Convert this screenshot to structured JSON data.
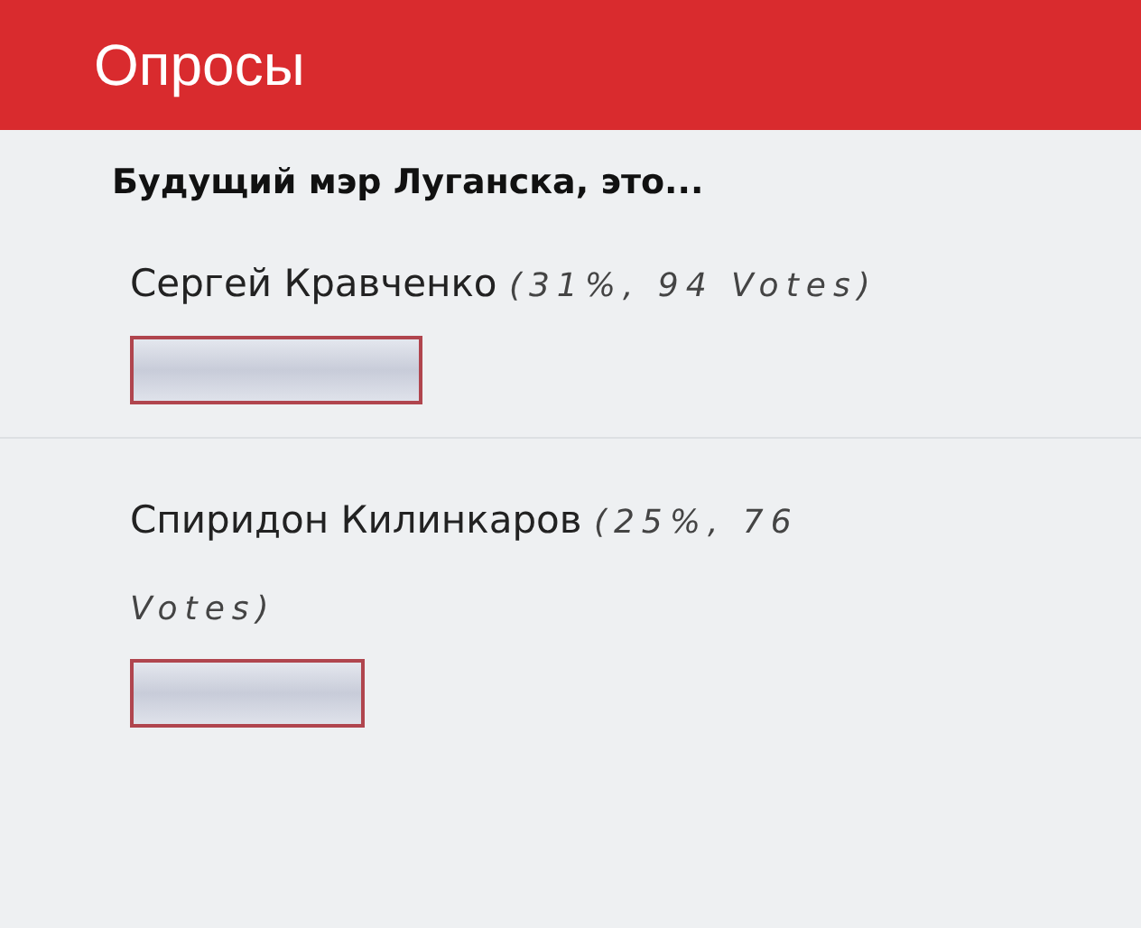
{
  "header": {
    "title": "Опросы"
  },
  "poll": {
    "question": "Будущий мэр Луганска, это...",
    "options": [
      {
        "name": "Сергей Кравченко",
        "result": "(31%, 94 Votes)"
      },
      {
        "name": "Спиридон Килинкаров",
        "result": "(25%, 76 Votes)"
      }
    ]
  }
}
